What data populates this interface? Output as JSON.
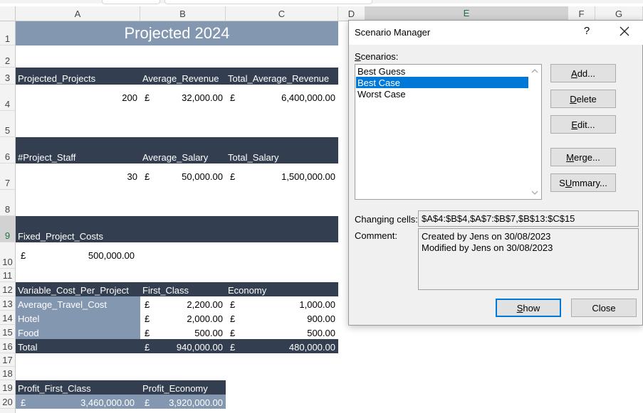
{
  "columns": [
    "A",
    "B",
    "C",
    "D",
    "E",
    "F",
    "G"
  ],
  "rows": [
    "1",
    "2",
    "3",
    "4",
    "5",
    "6",
    "7",
    "8",
    "9",
    "10",
    "11",
    "12",
    "13",
    "14",
    "15",
    "16",
    "17",
    "18",
    "19",
    "20"
  ],
  "sheet": {
    "title": "Projected 2024",
    "r3": {
      "a": "Projected_Projects",
      "b": "Average_Revenue",
      "c": "Total_Average_Revenue"
    },
    "r4": {
      "a": "200",
      "b_cur": "£",
      "b": "32,000.00",
      "c_cur": "£",
      "c": "6,400,000.00"
    },
    "r6": {
      "a": "#Project_Staff",
      "b": "Average_Salary",
      "c": "Total_Salary"
    },
    "r7": {
      "a": "30",
      "b_cur": "£",
      "b": "50,000.00",
      "c_cur": "£",
      "c": "1,500,000.00"
    },
    "r9": {
      "a": "Fixed_Project_Costs"
    },
    "r10": {
      "a_cur": "£",
      "a": "500,000.00"
    },
    "r12": {
      "a": "Variable_Cost_Per_Project",
      "b": "First_Class",
      "c": "Economy"
    },
    "r13": {
      "a": "Average_Travel_Cost",
      "b_cur": "£",
      "b": "2,200.00",
      "c_cur": "£",
      "c": "1,000.00"
    },
    "r14": {
      "a": "Hotel",
      "b_cur": "£",
      "b": "2,000.00",
      "c_cur": "£",
      "c": "900.00"
    },
    "r15": {
      "a": "Food",
      "b_cur": "£",
      "b": "500.00",
      "c_cur": "£",
      "c": "500.00"
    },
    "r16": {
      "a": "Total",
      "b_cur": "£",
      "b": "940,000.00",
      "c_cur": "£",
      "c": "480,000.00"
    },
    "r19": {
      "a": "Profit_First_Class",
      "b": "Profit_Economy"
    },
    "r20": {
      "a_cur": "£",
      "a": "3,460,000.00",
      "b_cur": "£",
      "b": "3,920,000.00"
    }
  },
  "dialog": {
    "title": "Scenario Manager",
    "help": "?",
    "scenarios_label_u": "S",
    "scenarios_label_rest": "cenarios:",
    "scenarios": [
      "Best Guess",
      "Best Case",
      "Worst Case"
    ],
    "selected_index": 1,
    "buttons": {
      "add_u": "A",
      "add_rest": "dd...",
      "delete_u": "D",
      "delete_rest": "elete",
      "edit_u": "E",
      "edit_rest": "dit...",
      "merge_u": "M",
      "merge_rest": "erge...",
      "summary_u": "U",
      "summary_pre": "S",
      "summary_rest": "mmary...",
      "show_u": "S",
      "show_rest": "how",
      "close": "Close"
    },
    "changing_cells_label": "Changing cells:",
    "changing_cells_value": "$A$4:$B$4,$A$7:$B$7,$B$13:$C$15",
    "comment_label": "Comment:",
    "comment_line1": "Created by Jens on 30/08/2023",
    "comment_line2": "Modified by Jens on 30/08/2023"
  }
}
